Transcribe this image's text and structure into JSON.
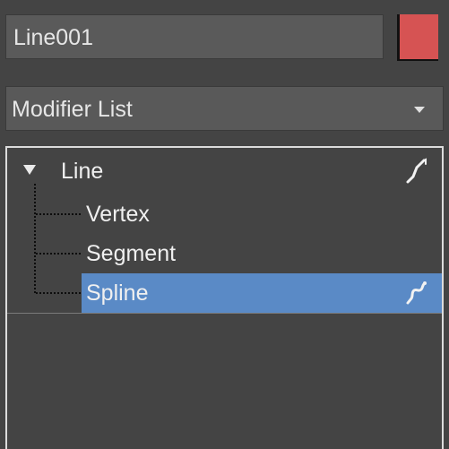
{
  "object": {
    "name": "Line001",
    "color": "#d65353"
  },
  "modifier_list": {
    "label": "Modifier List"
  },
  "stack": {
    "root": {
      "label": "Line",
      "expanded": true,
      "icon": "pin-icon"
    },
    "sub_objects": [
      {
        "label": "Vertex",
        "selected": false
      },
      {
        "label": "Segment",
        "selected": false
      },
      {
        "label": "Spline",
        "selected": true,
        "icon": "pin-icon"
      }
    ],
    "selection_color": "#5a8ac6"
  }
}
